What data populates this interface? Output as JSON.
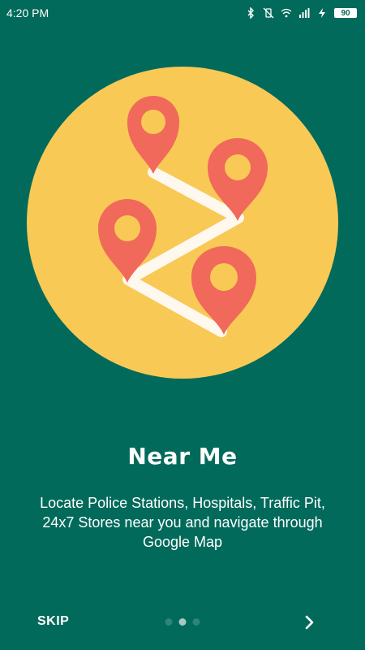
{
  "status_bar": {
    "time": "4:20 PM",
    "battery": "90",
    "icons": [
      "bluetooth-icon",
      "vibrate-off-icon",
      "wifi-icon",
      "signal-icon",
      "charging-icon"
    ]
  },
  "slide": {
    "title": "Near Me",
    "description": "Locate Police Stations, Hospitals, Traffic Pit, 24x7 Stores near you and navigate through Google Map",
    "illustration": "map-route-pins-icon"
  },
  "footer": {
    "skip_label": "SKIP",
    "next_icon": "chevron-right-icon",
    "page_count": 3,
    "active_page": 2
  },
  "colors": {
    "background": "#016A5B",
    "circle": "#F9C956",
    "pin": "#F0695A",
    "route": "#FFF8EE"
  }
}
